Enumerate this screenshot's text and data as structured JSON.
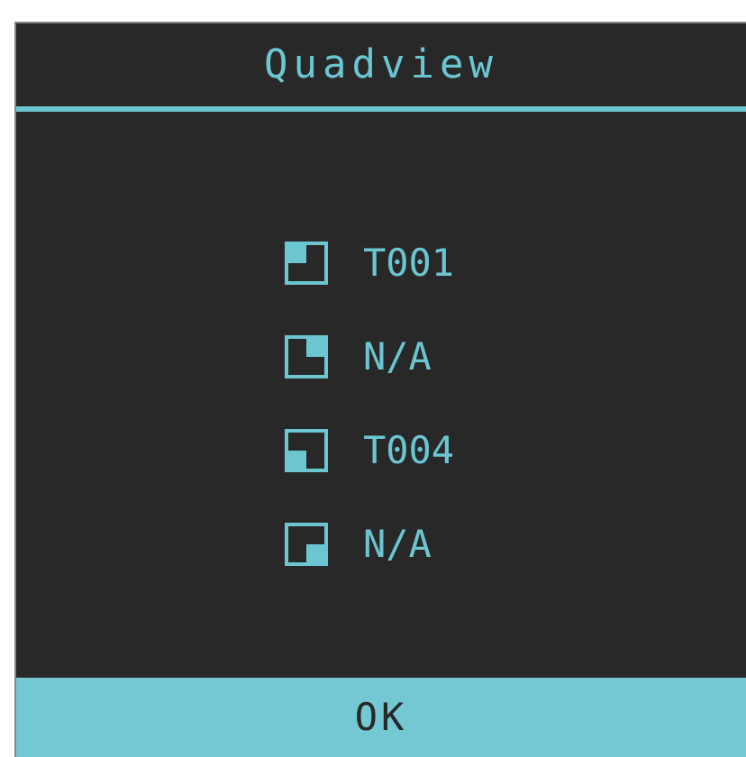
{
  "window": {
    "title": "Quadview"
  },
  "items": [
    {
      "kind": "topleft",
      "label": "T001"
    },
    {
      "kind": "topright",
      "label": "N/A"
    },
    {
      "kind": "bottomleft",
      "label": "T004"
    },
    {
      "kind": "bottomright",
      "label": "N/A"
    }
  ],
  "buttons": [
    "OK"
  ]
}
